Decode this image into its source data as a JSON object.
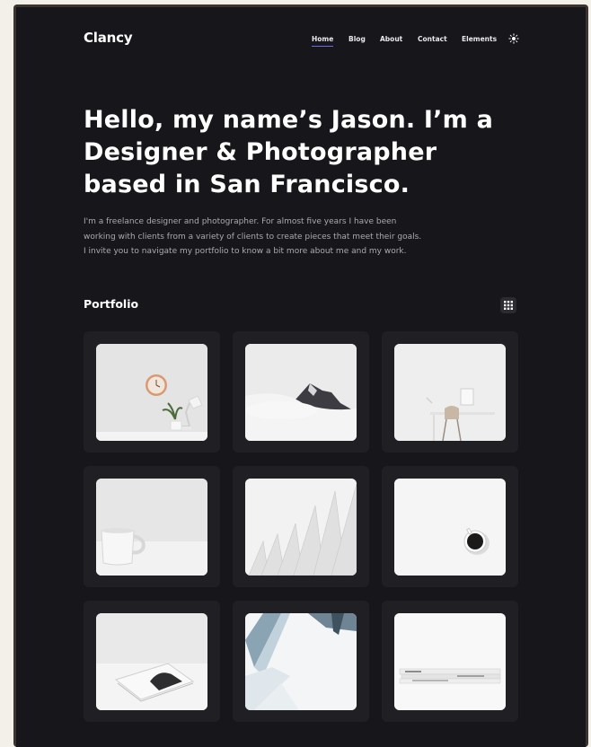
{
  "site": {
    "logo": "Clancy"
  },
  "nav": {
    "items": [
      {
        "label": "Home",
        "active": true
      },
      {
        "label": "Blog",
        "active": false
      },
      {
        "label": "About",
        "active": false
      },
      {
        "label": "Contact",
        "active": false
      },
      {
        "label": "Elements",
        "active": false
      }
    ],
    "theme_icon": "sun-icon"
  },
  "hero": {
    "title_lines": [
      "Hello, my name’s Jason. I’m a",
      "Designer & Photographer",
      "based in San Francisco."
    ],
    "description_lines": [
      "I'm a freelance designer and photographer. For almost five years I have been",
      "working with clients from a variety of clients to create pieces that meet their goals.",
      "I invite you to navigate my portfolio to know a bit more about me and my work."
    ]
  },
  "portfolio": {
    "title": "Portfolio",
    "view_icon": "grid-icon",
    "items": [
      {
        "icon": "wall-clock-lamp-photo"
      },
      {
        "icon": "misty-mountain-photo"
      },
      {
        "icon": "desk-chair-photo"
      },
      {
        "icon": "white-mug-photo"
      },
      {
        "icon": "white-fins-architecture-photo"
      },
      {
        "icon": "coffee-cup-photo"
      },
      {
        "icon": "tablet-on-table-photo"
      },
      {
        "icon": "skyscraper-photo"
      },
      {
        "icon": "magazines-photo"
      }
    ]
  },
  "colors": {
    "page_background": "#17171b",
    "card_background": "#1f1f24",
    "accent": "#6a6cf0",
    "text_primary": "#ffffff",
    "text_secondary": "#a9a9b1"
  }
}
